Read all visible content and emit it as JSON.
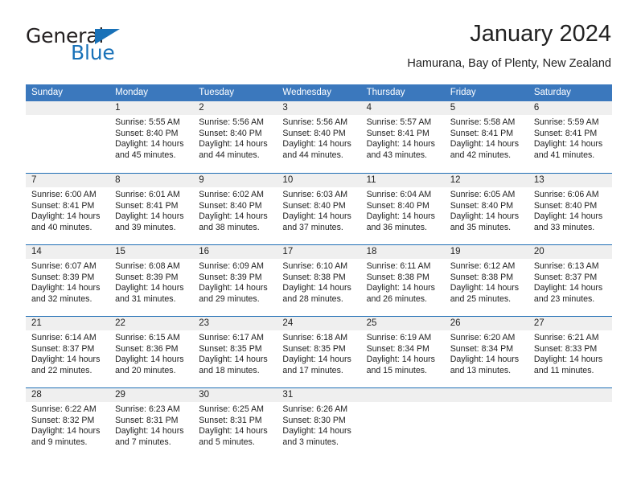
{
  "brand": {
    "name_part1": "General",
    "name_part2": "Blue",
    "triangle_icon": "triangle-icon",
    "accent_color": "#1871b8"
  },
  "header": {
    "title": "January 2024",
    "subtitle": "Hamurana, Bay of Plenty, New Zealand"
  },
  "theme": {
    "header_blue": "#3b78bd",
    "rule_blue": "#1f6eb5",
    "daynum_bg": "#efefef",
    "text": "#222222"
  },
  "calendar": {
    "weekday_headers": [
      "Sunday",
      "Monday",
      "Tuesday",
      "Wednesday",
      "Thursday",
      "Friday",
      "Saturday"
    ],
    "weeks": [
      [
        {
          "day": "",
          "sunrise": "",
          "sunset": "",
          "daylight": "",
          "empty": true
        },
        {
          "day": "1",
          "sunrise": "Sunrise: 5:55 AM",
          "sunset": "Sunset: 8:40 PM",
          "daylight": "Daylight: 14 hours and 45 minutes."
        },
        {
          "day": "2",
          "sunrise": "Sunrise: 5:56 AM",
          "sunset": "Sunset: 8:40 PM",
          "daylight": "Daylight: 14 hours and 44 minutes."
        },
        {
          "day": "3",
          "sunrise": "Sunrise: 5:56 AM",
          "sunset": "Sunset: 8:40 PM",
          "daylight": "Daylight: 14 hours and 44 minutes."
        },
        {
          "day": "4",
          "sunrise": "Sunrise: 5:57 AM",
          "sunset": "Sunset: 8:41 PM",
          "daylight": "Daylight: 14 hours and 43 minutes."
        },
        {
          "day": "5",
          "sunrise": "Sunrise: 5:58 AM",
          "sunset": "Sunset: 8:41 PM",
          "daylight": "Daylight: 14 hours and 42 minutes."
        },
        {
          "day": "6",
          "sunrise": "Sunrise: 5:59 AM",
          "sunset": "Sunset: 8:41 PM",
          "daylight": "Daylight: 14 hours and 41 minutes."
        }
      ],
      [
        {
          "day": "7",
          "sunrise": "Sunrise: 6:00 AM",
          "sunset": "Sunset: 8:41 PM",
          "daylight": "Daylight: 14 hours and 40 minutes."
        },
        {
          "day": "8",
          "sunrise": "Sunrise: 6:01 AM",
          "sunset": "Sunset: 8:41 PM",
          "daylight": "Daylight: 14 hours and 39 minutes."
        },
        {
          "day": "9",
          "sunrise": "Sunrise: 6:02 AM",
          "sunset": "Sunset: 8:40 PM",
          "daylight": "Daylight: 14 hours and 38 minutes."
        },
        {
          "day": "10",
          "sunrise": "Sunrise: 6:03 AM",
          "sunset": "Sunset: 8:40 PM",
          "daylight": "Daylight: 14 hours and 37 minutes."
        },
        {
          "day": "11",
          "sunrise": "Sunrise: 6:04 AM",
          "sunset": "Sunset: 8:40 PM",
          "daylight": "Daylight: 14 hours and 36 minutes."
        },
        {
          "day": "12",
          "sunrise": "Sunrise: 6:05 AM",
          "sunset": "Sunset: 8:40 PM",
          "daylight": "Daylight: 14 hours and 35 minutes."
        },
        {
          "day": "13",
          "sunrise": "Sunrise: 6:06 AM",
          "sunset": "Sunset: 8:40 PM",
          "daylight": "Daylight: 14 hours and 33 minutes."
        }
      ],
      [
        {
          "day": "14",
          "sunrise": "Sunrise: 6:07 AM",
          "sunset": "Sunset: 8:39 PM",
          "daylight": "Daylight: 14 hours and 32 minutes."
        },
        {
          "day": "15",
          "sunrise": "Sunrise: 6:08 AM",
          "sunset": "Sunset: 8:39 PM",
          "daylight": "Daylight: 14 hours and 31 minutes."
        },
        {
          "day": "16",
          "sunrise": "Sunrise: 6:09 AM",
          "sunset": "Sunset: 8:39 PM",
          "daylight": "Daylight: 14 hours and 29 minutes."
        },
        {
          "day": "17",
          "sunrise": "Sunrise: 6:10 AM",
          "sunset": "Sunset: 8:38 PM",
          "daylight": "Daylight: 14 hours and 28 minutes."
        },
        {
          "day": "18",
          "sunrise": "Sunrise: 6:11 AM",
          "sunset": "Sunset: 8:38 PM",
          "daylight": "Daylight: 14 hours and 26 minutes."
        },
        {
          "day": "19",
          "sunrise": "Sunrise: 6:12 AM",
          "sunset": "Sunset: 8:38 PM",
          "daylight": "Daylight: 14 hours and 25 minutes."
        },
        {
          "day": "20",
          "sunrise": "Sunrise: 6:13 AM",
          "sunset": "Sunset: 8:37 PM",
          "daylight": "Daylight: 14 hours and 23 minutes."
        }
      ],
      [
        {
          "day": "21",
          "sunrise": "Sunrise: 6:14 AM",
          "sunset": "Sunset: 8:37 PM",
          "daylight": "Daylight: 14 hours and 22 minutes."
        },
        {
          "day": "22",
          "sunrise": "Sunrise: 6:15 AM",
          "sunset": "Sunset: 8:36 PM",
          "daylight": "Daylight: 14 hours and 20 minutes."
        },
        {
          "day": "23",
          "sunrise": "Sunrise: 6:17 AM",
          "sunset": "Sunset: 8:35 PM",
          "daylight": "Daylight: 14 hours and 18 minutes."
        },
        {
          "day": "24",
          "sunrise": "Sunrise: 6:18 AM",
          "sunset": "Sunset: 8:35 PM",
          "daylight": "Daylight: 14 hours and 17 minutes."
        },
        {
          "day": "25",
          "sunrise": "Sunrise: 6:19 AM",
          "sunset": "Sunset: 8:34 PM",
          "daylight": "Daylight: 14 hours and 15 minutes."
        },
        {
          "day": "26",
          "sunrise": "Sunrise: 6:20 AM",
          "sunset": "Sunset: 8:34 PM",
          "daylight": "Daylight: 14 hours and 13 minutes."
        },
        {
          "day": "27",
          "sunrise": "Sunrise: 6:21 AM",
          "sunset": "Sunset: 8:33 PM",
          "daylight": "Daylight: 14 hours and 11 minutes."
        }
      ],
      [
        {
          "day": "28",
          "sunrise": "Sunrise: 6:22 AM",
          "sunset": "Sunset: 8:32 PM",
          "daylight": "Daylight: 14 hours and 9 minutes."
        },
        {
          "day": "29",
          "sunrise": "Sunrise: 6:23 AM",
          "sunset": "Sunset: 8:31 PM",
          "daylight": "Daylight: 14 hours and 7 minutes."
        },
        {
          "day": "30",
          "sunrise": "Sunrise: 6:25 AM",
          "sunset": "Sunset: 8:31 PM",
          "daylight": "Daylight: 14 hours and 5 minutes."
        },
        {
          "day": "31",
          "sunrise": "Sunrise: 6:26 AM",
          "sunset": "Sunset: 8:30 PM",
          "daylight": "Daylight: 14 hours and 3 minutes."
        },
        {
          "day": "",
          "sunrise": "",
          "sunset": "",
          "daylight": "",
          "empty": true
        },
        {
          "day": "",
          "sunrise": "",
          "sunset": "",
          "daylight": "",
          "empty": true
        },
        {
          "day": "",
          "sunrise": "",
          "sunset": "",
          "daylight": "",
          "empty": true
        }
      ]
    ]
  }
}
